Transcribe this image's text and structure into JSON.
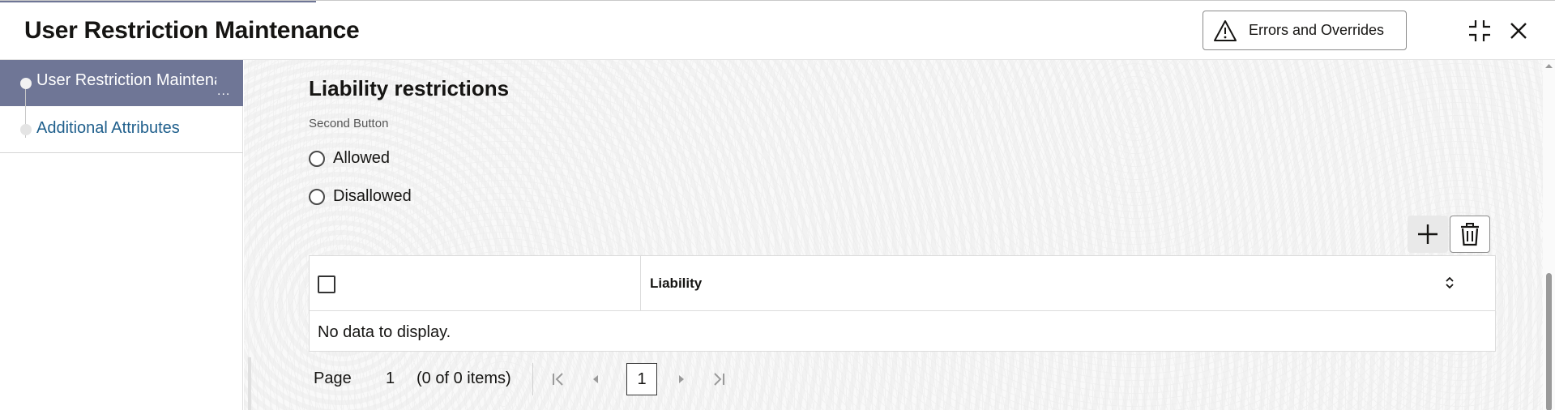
{
  "header": {
    "title": "User Restriction Maintenance",
    "errors_button_label": "Errors and Overrides",
    "icons": [
      "warning-icon",
      "collapse-icon",
      "close-icon"
    ]
  },
  "sidebar": {
    "items": [
      {
        "label": "User Restriction Maintenance",
        "active": true,
        "overflow_indicator": "..."
      },
      {
        "label": "Additional Attributes",
        "active": false
      }
    ]
  },
  "main": {
    "section_title": "Liability restrictions",
    "field_label": "Second Button",
    "radio_options": [
      {
        "label": "Allowed",
        "selected": false
      },
      {
        "label": "Disallowed",
        "selected": false
      }
    ],
    "toolbar": {
      "add_icon": "plus-icon",
      "delete_icon": "trash-icon"
    },
    "table": {
      "columns": [
        "",
        "Liability"
      ],
      "empty_message": "No data to display."
    },
    "pagination": {
      "page_label": "Page",
      "page_number": "1",
      "items_summary": "(0 of 0 items)",
      "current_page": "1"
    }
  },
  "colors": {
    "active_nav_bg": "#6f7696",
    "link_text": "#1f5f8c",
    "text": "#161513"
  }
}
